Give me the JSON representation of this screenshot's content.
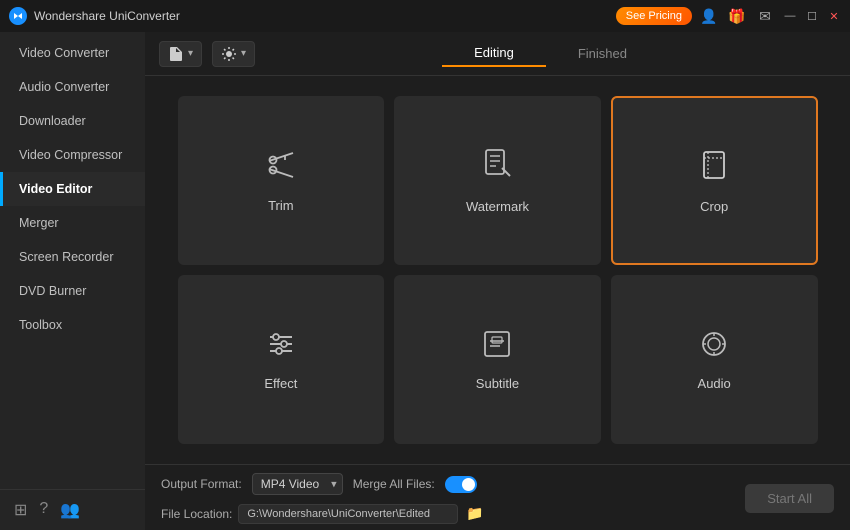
{
  "titleBar": {
    "appName": "Wondershare UniConverter",
    "seePricingLabel": "See Pricing",
    "icons": {
      "user": "👤",
      "gift": "🎁",
      "mail": "✉",
      "minimize": "—",
      "maximize": "☐",
      "close": "✕"
    }
  },
  "sidebar": {
    "items": [
      {
        "id": "video-converter",
        "label": "Video Converter",
        "active": false
      },
      {
        "id": "audio-converter",
        "label": "Audio Converter",
        "active": false
      },
      {
        "id": "downloader",
        "label": "Downloader",
        "active": false
      },
      {
        "id": "video-compressor",
        "label": "Video Compressor",
        "active": false
      },
      {
        "id": "video-editor",
        "label": "Video Editor",
        "active": true
      },
      {
        "id": "merger",
        "label": "Merger",
        "active": false
      },
      {
        "id": "screen-recorder",
        "label": "Screen Recorder",
        "active": false
      },
      {
        "id": "dvd-burner",
        "label": "DVD Burner",
        "active": false
      },
      {
        "id": "toolbox",
        "label": "Toolbox",
        "active": false
      }
    ],
    "footerIcons": [
      "⊞",
      "?",
      "👥"
    ]
  },
  "toolbar": {
    "addFilesIcon": "📄",
    "addFilesLabel": "",
    "settingsIcon": "⚙",
    "settingsLabel": ""
  },
  "tabs": [
    {
      "id": "editing",
      "label": "Editing",
      "active": true
    },
    {
      "id": "finished",
      "label": "Finished",
      "active": false
    }
  ],
  "editorCards": [
    {
      "id": "trim",
      "label": "Trim",
      "icon": "✂",
      "selected": false
    },
    {
      "id": "watermark",
      "label": "Watermark",
      "icon": "🖹",
      "selected": false
    },
    {
      "id": "crop",
      "label": "Crop",
      "icon": "⬜",
      "selected": true
    },
    {
      "id": "effect",
      "label": "Effect",
      "icon": "≡",
      "selected": false
    },
    {
      "id": "subtitle",
      "label": "Subtitle",
      "icon": "⊡",
      "selected": false
    },
    {
      "id": "audio",
      "label": "Audio",
      "icon": "◎",
      "selected": false
    }
  ],
  "bottomBar": {
    "outputFormatLabel": "Output Format:",
    "outputFormatValue": "MP4 Video",
    "mergeAllFilesLabel": "Merge All Files:",
    "fileLocationLabel": "File Location:",
    "fileLocationPath": "G:\\Wondershare\\UniConverter\\Edited",
    "startAllLabel": "Start All"
  }
}
